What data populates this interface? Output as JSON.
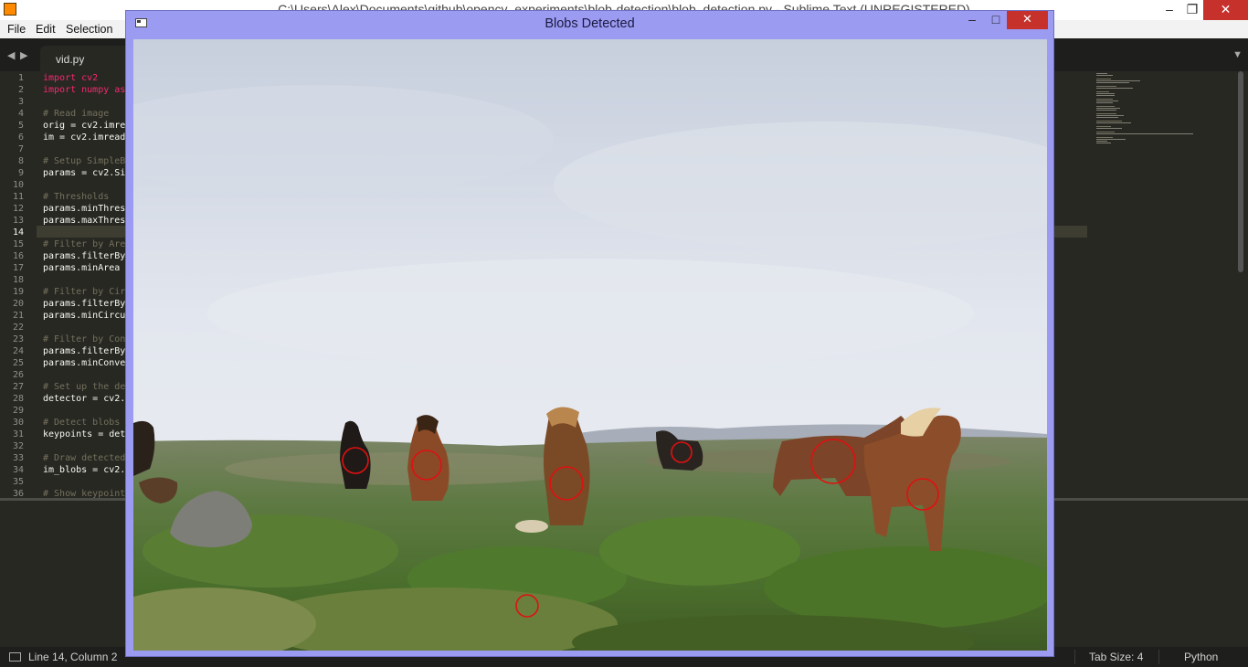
{
  "sublime": {
    "window_title": "C:\\Users\\Alex\\Documents\\github\\opencv_experiments\\blob-detection\\blob_detection.py - Sublime Text (UNREGISTERED)",
    "menu": [
      "File",
      "Edit",
      "Selection"
    ],
    "tab": {
      "label": "vid.py"
    },
    "lines": [
      {
        "n": "1",
        "text": "import cv2",
        "style": "kw"
      },
      {
        "n": "2",
        "text": "import numpy as",
        "style": "kw"
      },
      {
        "n": "3",
        "text": "",
        "style": "pl"
      },
      {
        "n": "4",
        "text": "# Read image",
        "style": "cm"
      },
      {
        "n": "5",
        "text": "orig = cv2.imre",
        "style": "pl"
      },
      {
        "n": "6",
        "text": "im = cv2.imread",
        "style": "pl"
      },
      {
        "n": "7",
        "text": "",
        "style": "pl"
      },
      {
        "n": "8",
        "text": "# Setup SimpleB",
        "style": "cm"
      },
      {
        "n": "9",
        "text": "params = cv2.Si",
        "style": "pl"
      },
      {
        "n": "10",
        "text": "",
        "style": "pl"
      },
      {
        "n": "11",
        "text": "# Thresholds",
        "style": "cm"
      },
      {
        "n": "12",
        "text": "params.minThres",
        "style": "pl"
      },
      {
        "n": "13",
        "text": "params.maxThres",
        "style": "pl"
      },
      {
        "n": "14",
        "text": "",
        "style": "pl"
      },
      {
        "n": "15",
        "text": "# Filter by Are",
        "style": "cm"
      },
      {
        "n": "16",
        "text": "params.filterBy",
        "style": "pl"
      },
      {
        "n": "17",
        "text": "params.minArea",
        "style": "pl"
      },
      {
        "n": "18",
        "text": "",
        "style": "pl"
      },
      {
        "n": "19",
        "text": "# Filter by Cir",
        "style": "cm"
      },
      {
        "n": "20",
        "text": "params.filterBy",
        "style": "pl"
      },
      {
        "n": "21",
        "text": "params.minCircu",
        "style": "pl"
      },
      {
        "n": "22",
        "text": "",
        "style": "pl"
      },
      {
        "n": "23",
        "text": "# Filter by Con",
        "style": "cm"
      },
      {
        "n": "24",
        "text": "params.filterBy",
        "style": "pl"
      },
      {
        "n": "25",
        "text": "params.minConve",
        "style": "pl"
      },
      {
        "n": "26",
        "text": "",
        "style": "pl"
      },
      {
        "n": "27",
        "text": "# Set up the de",
        "style": "cm"
      },
      {
        "n": "28",
        "text": "detector = cv2.",
        "style": "pl"
      },
      {
        "n": "29",
        "text": "",
        "style": "pl"
      },
      {
        "n": "30",
        "text": "# Detect blobs",
        "style": "cm"
      },
      {
        "n": "31",
        "text": "keypoints = det",
        "style": "pl"
      },
      {
        "n": "32",
        "text": "",
        "style": "pl"
      },
      {
        "n": "33",
        "text": "# Draw detected",
        "style": "cm"
      },
      {
        "n": "34",
        "text": "im_blobs = cv2.",
        "style": "pl"
      },
      {
        "n": "35",
        "text": "",
        "style": "pl"
      },
      {
        "n": "36",
        "text": "# Show keypoint",
        "style": "cm"
      }
    ],
    "current_line": 14,
    "status": {
      "position": "Line 14, Column 2",
      "tab_size": "Tab Size: 4",
      "syntax": "Python"
    }
  },
  "cv_window": {
    "title": "Blobs Detected",
    "blob_circle_color": "#e01010"
  },
  "colors": {
    "editor_bg": "#272822",
    "cv_frame": "#9b9bf2",
    "close_button": "#c7312b"
  }
}
